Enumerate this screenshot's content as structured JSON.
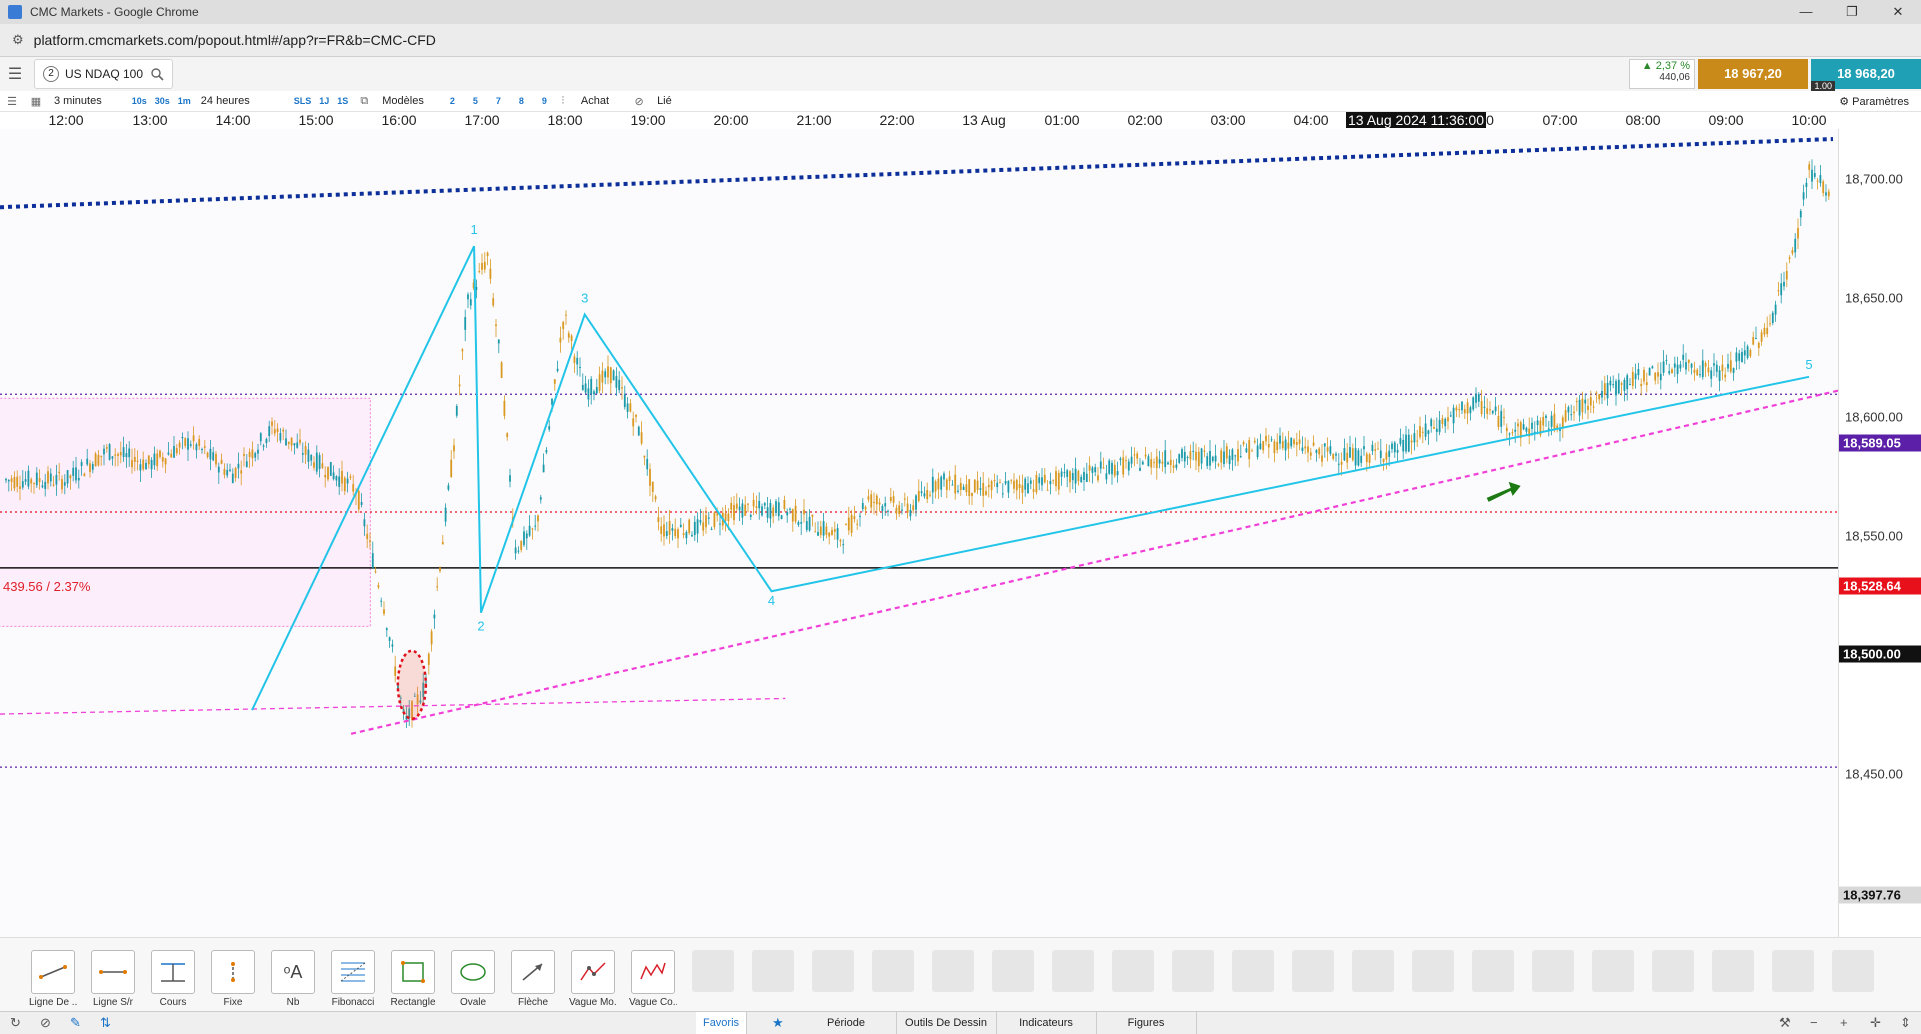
{
  "window": {
    "title": "CMC Markets - Google Chrome",
    "controls": [
      "—",
      "❐",
      "✕"
    ]
  },
  "address": {
    "url": "platform.cmcmarkets.com/popout.html#/app?r=FR&b=CMC-CFD"
  },
  "instrument": {
    "tab_number": "2",
    "name": "US NDAQ 100"
  },
  "quote": {
    "change_pct": "▲ 2,37 %",
    "change_pts": "440,06",
    "sell": "18 967,20",
    "buy": "18 968,20",
    "spread": "1.00"
  },
  "toolbar": {
    "interval": "3 minutes",
    "fast_intervals": [
      "10s",
      "30s",
      "1m"
    ],
    "range": "24 heures",
    "ranges": [
      "SLS",
      "1J",
      "1S"
    ],
    "models": "Modèles",
    "model_numbers": [
      "2",
      "5",
      "7",
      "8",
      "9"
    ],
    "buy": "Achat",
    "linked": "Lié",
    "settings": "Paramètres"
  },
  "time_axis": {
    "ticks": [
      "12:00",
      "13:00",
      "14:00",
      "15:00",
      "16:00",
      "17:00",
      "18:00",
      "19:00",
      "20:00",
      "21:00",
      "22:00",
      "13 Aug",
      "01:00",
      "02:00",
      "03:00",
      "04:00",
      "0",
      "07:00",
      "08:00",
      "09:00",
      "10:00"
    ],
    "cursor_label": "13 Aug 2024 11:36:00"
  },
  "price_axis": {
    "labels": [
      "18,700.00",
      "18,650.00",
      "18,600.00",
      "18,550.00",
      "18,450.00"
    ],
    "tags": [
      {
        "text": "18,589.05",
        "color": "#5b1fa8"
      },
      {
        "text": "18,528.64",
        "color": "#e8101a"
      },
      {
        "text": "18,500.00",
        "color": "#111111"
      },
      {
        "text": "18,397.76",
        "color": "#d8d8d8"
      }
    ]
  },
  "annotations": {
    "box_label": "439.56 / 2.37%",
    "wave_labels": [
      "1",
      "2",
      "3",
      "4",
      "5"
    ]
  },
  "drawing_tools": [
    {
      "label": "Ligne De ...",
      "icon": "trend-line-icon"
    },
    {
      "label": "Ligne S/r",
      "icon": "sr-line-icon"
    },
    {
      "label": "Cours",
      "icon": "price-line-icon"
    },
    {
      "label": "Fixe",
      "icon": "fixed-line-icon"
    },
    {
      "label": "Nb",
      "icon": "text-icon"
    },
    {
      "label": "Fibonacci",
      "icon": "fibonacci-icon"
    },
    {
      "label": "Rectangle",
      "icon": "rectangle-icon"
    },
    {
      "label": "Ovale",
      "icon": "oval-icon"
    },
    {
      "label": "Flèche",
      "icon": "arrow-icon"
    },
    {
      "label": "Vague Mo...",
      "icon": "wave-motive-icon"
    },
    {
      "label": "Vague Co...",
      "icon": "wave-corrective-icon"
    }
  ],
  "bottom_tabs": [
    "Favoris",
    "Période",
    "Outils De Dessin",
    "Indicateurs",
    "Figures"
  ],
  "chart_data": {
    "type": "candlestick",
    "instrument": "US NDAQ 100",
    "timeframe": "3 minutes",
    "ylim": [
      18380,
      18725
    ],
    "grid": false,
    "path_points": [
      [
        "12:00",
        18545
      ],
      [
        "12:30",
        18560
      ],
      [
        "13:00",
        18553
      ],
      [
        "13:30",
        18565
      ],
      [
        "14:00",
        18548
      ],
      [
        "14:30",
        18572
      ],
      [
        "15:00",
        18555
      ],
      [
        "15:30",
        18540
      ],
      [
        "15:50",
        18480
      ],
      [
        "16:05",
        18420
      ],
      [
        "16:20",
        18440
      ],
      [
        "16:40",
        18560
      ],
      [
        "16:50",
        18635
      ],
      [
        "17:05",
        18660
      ],
      [
        "17:15",
        18600
      ],
      [
        "17:25",
        18510
      ],
      [
        "17:40",
        18520
      ],
      [
        "18:00",
        18630
      ],
      [
        "18:15",
        18590
      ],
      [
        "18:35",
        18600
      ],
      [
        "18:55",
        18570
      ],
      [
        "19:10",
        18520
      ],
      [
        "19:35",
        18520
      ],
      [
        "20:05",
        18530
      ],
      [
        "20:40",
        18530
      ],
      [
        "21:20",
        18515
      ],
      [
        "21:40",
        18535
      ],
      [
        "22:10",
        18530
      ],
      [
        "22:30",
        18545
      ],
      [
        "23:00",
        18540
      ],
      [
        "13 Aug 00:00",
        18545
      ],
      [
        "01:00",
        18555
      ],
      [
        "02:00",
        18558
      ],
      [
        "02:40",
        18565
      ],
      [
        "03:00",
        18560
      ],
      [
        "03:30",
        18557
      ],
      [
        "04:00",
        18560
      ],
      [
        "05:00",
        18585
      ],
      [
        "05:30",
        18570
      ],
      [
        "06:00",
        18575
      ],
      [
        "06:30",
        18590
      ],
      [
        "07:00",
        18598
      ],
      [
        "07:30",
        18605
      ],
      [
        "08:00",
        18600
      ],
      [
        "08:30",
        18622
      ],
      [
        "08:50",
        18665
      ],
      [
        "09:00",
        18705
      ],
      [
        "09:15",
        18690
      ],
      [
        "09:40",
        18680
      ],
      [
        "10:00",
        18650
      ]
    ],
    "levels": [
      {
        "value": 18589.05,
        "style": "dotted",
        "color": "#5b1fa8"
      },
      {
        "value": 18528.64,
        "style": "dotted",
        "color": "#e8101a"
      },
      {
        "value": 18500.0,
        "style": "solid",
        "color": "#111111"
      },
      {
        "value": 18397.76,
        "style": "dotted",
        "color": "#5b1fa8"
      }
    ],
    "elliott_wave": [
      [
        "15:50",
        18426
      ],
      [
        "16:55",
        18665
      ],
      [
        "17:00",
        18477
      ],
      [
        "18:15",
        18630
      ],
      [
        "20:30",
        18488
      ],
      [
        "09:00",
        18598
      ]
    ],
    "wave_trendline": [
      [
        "20:30",
        18488
      ],
      [
        "09:00",
        18598
      ]
    ],
    "upper_trendline": [
      [
        "11:40",
        18685
      ],
      [
        "10:10",
        18720
      ]
    ],
    "support_line_magenta": [
      [
        "15:55",
        18420
      ],
      [
        "09:35",
        18594
      ]
    ],
    "flat_line_magenta": [
      [
        "11:40",
        18425
      ],
      [
        "20:40",
        18433
      ]
    ],
    "zone_rect": {
      "from_time": "11:40",
      "to_time": "15:40",
      "from_price": 18470,
      "to_price": 18587,
      "color": "#ff7fd8"
    },
    "marker_oval": [
      "16:10",
      18440
    ],
    "arrow_marker": [
      "05:20",
      18540
    ]
  }
}
